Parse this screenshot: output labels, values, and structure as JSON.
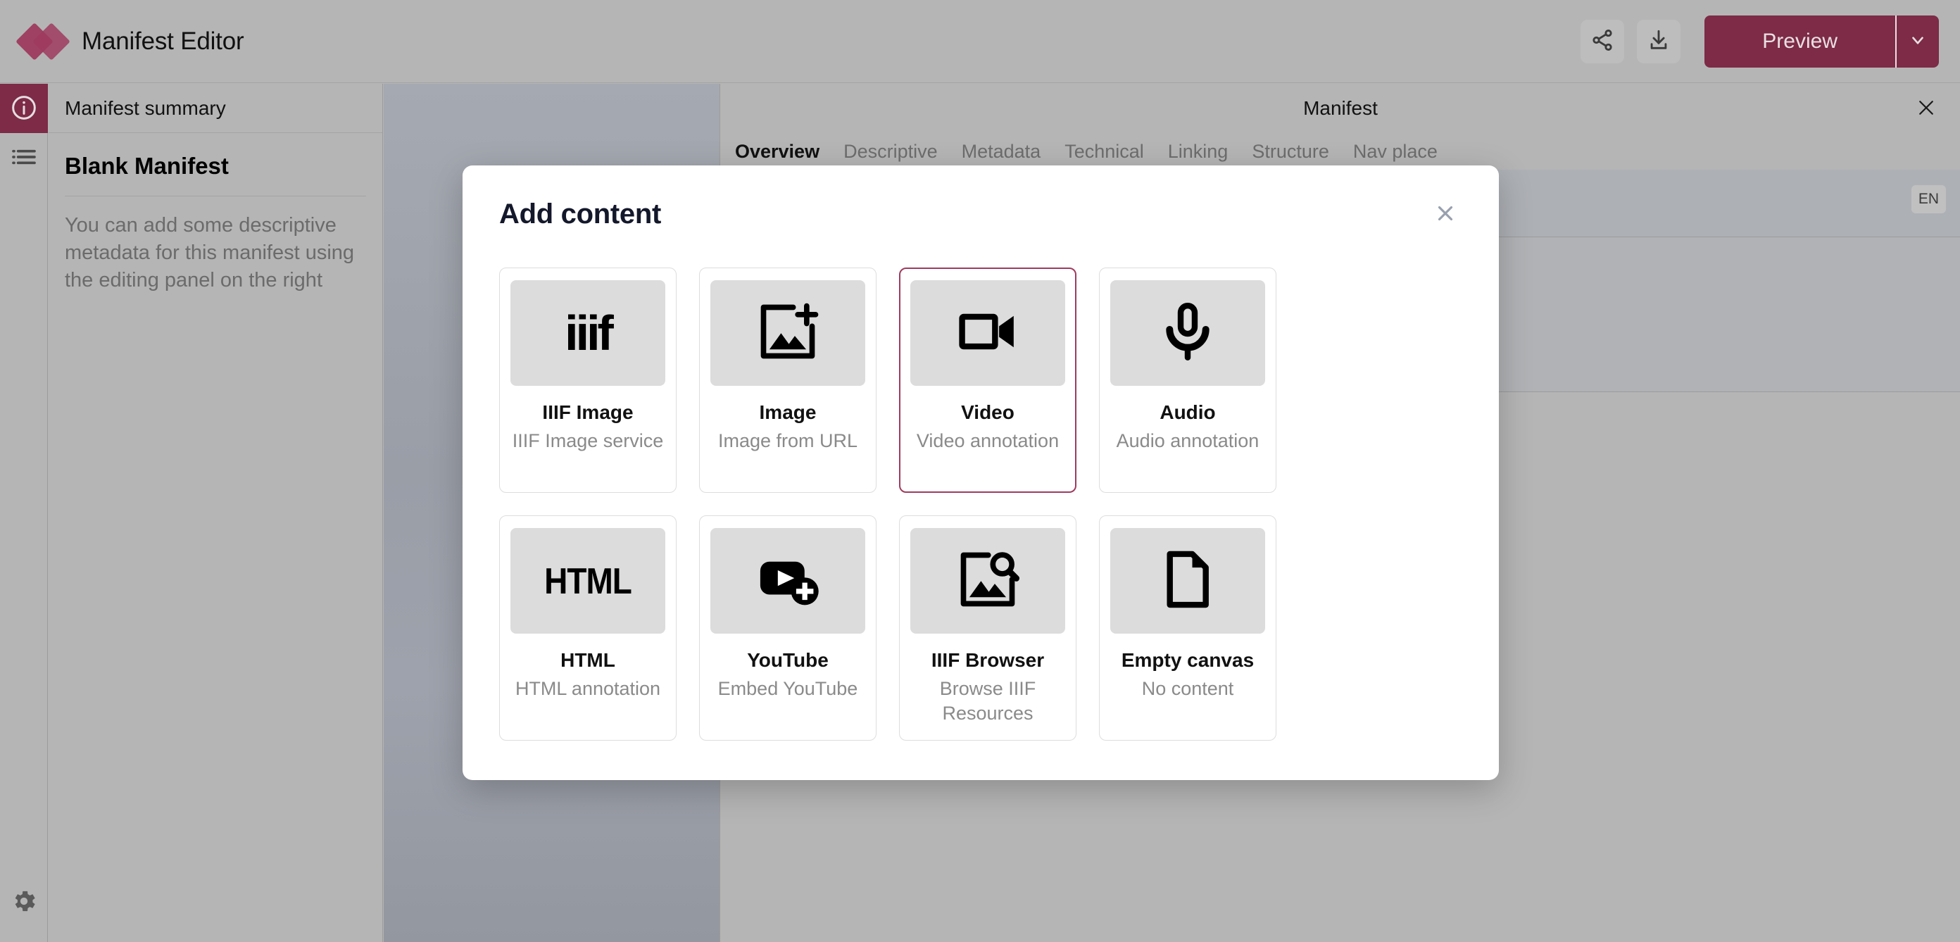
{
  "app": {
    "title": "Manifest Editor",
    "logo_color": "#9e3b5e"
  },
  "toolbar": {
    "share_icon": "share-icon",
    "download_icon": "download-icon",
    "preview_label": "Preview",
    "preview_caret_icon": "chevron-down-icon",
    "accent_color": "#7d2b47"
  },
  "rail": {
    "items": [
      {
        "icon": "info-circle-icon",
        "name": "info",
        "active": true
      },
      {
        "icon": "list-icon",
        "name": "list",
        "active": false
      }
    ],
    "bottom": {
      "icon": "gear-icon",
      "name": "settings"
    }
  },
  "summary": {
    "header": "Manifest summary",
    "title": "Blank Manifest",
    "description": "You can add some descriptive metadata for this manifest using the editing panel on the right"
  },
  "editor": {
    "title": "Manifest",
    "close_icon": "close-icon",
    "tabs": [
      {
        "label": "Overview",
        "active": true
      },
      {
        "label": "Descriptive",
        "active": false
      },
      {
        "label": "Metadata",
        "active": false
      },
      {
        "label": "Technical",
        "active": false
      },
      {
        "label": "Linking",
        "active": false
      },
      {
        "label": "Structure",
        "active": false
      },
      {
        "label": "Nav place",
        "active": false
      }
    ],
    "language_badge": "EN"
  },
  "modal": {
    "title": "Add content",
    "close_icon": "close-icon",
    "selected_border_color": "#9e3b5e",
    "cards": [
      {
        "icon": "iiif-logo-icon",
        "label": "IIIF Image",
        "desc": "IIIF Image service",
        "selected": false
      },
      {
        "icon": "image-add-icon",
        "label": "Image",
        "desc": "Image from URL",
        "selected": false
      },
      {
        "icon": "video-camera-icon",
        "label": "Video",
        "desc": "Video annotation",
        "selected": true
      },
      {
        "icon": "microphone-icon",
        "label": "Audio",
        "desc": "Audio annotation",
        "selected": false
      },
      {
        "icon": "html-logo-icon",
        "label": "HTML",
        "desc": "HTML annotation",
        "selected": false
      },
      {
        "icon": "youtube-add-icon",
        "label": "YouTube",
        "desc": "Embed YouTube",
        "selected": false
      },
      {
        "icon": "image-search-icon",
        "label": "IIIF Browser",
        "desc": "Browse IIIF Resources",
        "selected": false
      },
      {
        "icon": "document-icon",
        "label": "Empty canvas",
        "desc": "No content",
        "selected": false
      }
    ],
    "icon_glyphs": {
      "iiif-logo-icon": "iiif",
      "html-logo-icon": "HTML"
    }
  }
}
